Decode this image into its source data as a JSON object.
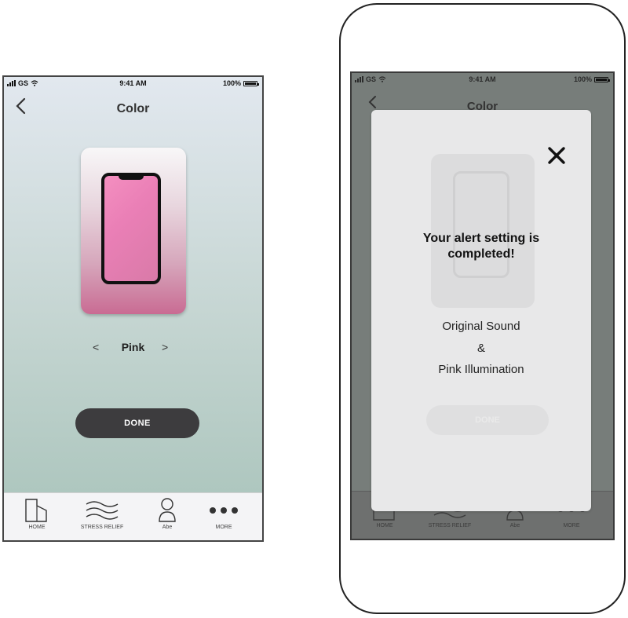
{
  "status_bar": {
    "carrier": "GS",
    "time": "9:41 AM",
    "battery": "100%"
  },
  "screen": {
    "title": "Color",
    "back_icon": "chevron-left-icon",
    "selected_color": "Pink",
    "prev_arrow": "<",
    "next_arrow": ">",
    "done_label": "DONE"
  },
  "tabs": [
    {
      "label": "HOME",
      "icon": "home-icon"
    },
    {
      "label": "STRESS RELIEF",
      "icon": "waves-icon"
    },
    {
      "label": "Abe",
      "icon": "user-icon"
    },
    {
      "label": "MORE",
      "icon": "more-icon"
    }
  ],
  "modal": {
    "close_icon": "close-icon",
    "title_line1": "Your alert setting is",
    "title_line2": "completed!",
    "line1": "Original Sound",
    "line2": "&",
    "line3": "Pink Illumination"
  },
  "colors": {
    "done_button": "#3d3c3e",
    "pink_screen": "#f48fc0",
    "overlay_dim": "#777d7a",
    "modal_bg": "#e8e8e9"
  }
}
